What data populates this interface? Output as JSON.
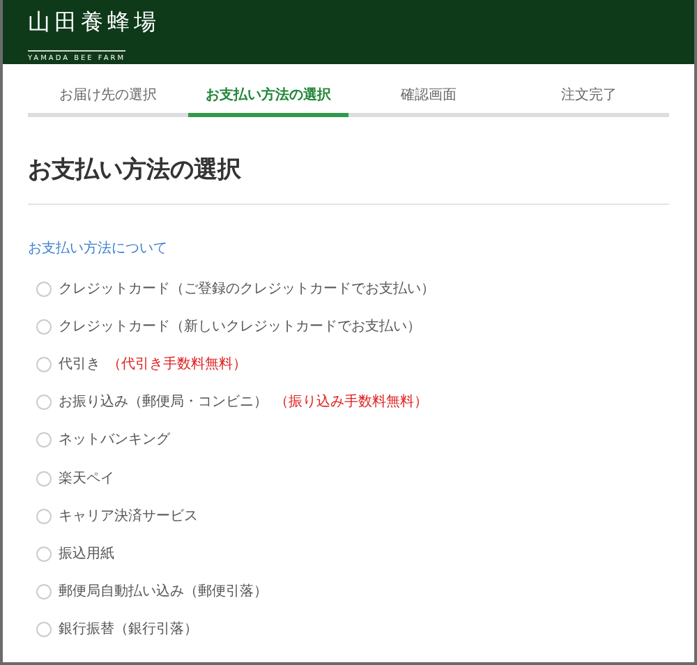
{
  "header": {
    "logo_title": "山田養蜂場",
    "logo_subtitle": "YAMADA BEE FARM"
  },
  "steps": [
    {
      "label": "お届け先の選択",
      "selected": false
    },
    {
      "label": "お支払い方法の選択",
      "selected": true
    },
    {
      "label": "確認画面",
      "selected": false
    },
    {
      "label": "注文完了",
      "selected": false
    }
  ],
  "page_title": "お支払い方法の選択",
  "help_link": "お支払い方法について",
  "payment_options": [
    {
      "label": "クレジットカード（ご登録のクレジットカードでお支払い）",
      "selected": false
    },
    {
      "label": "クレジットカード（新しいクレジットカードでお支払い）",
      "selected": false
    },
    {
      "label": "代引き",
      "note": "（代引き手数料無料）",
      "selected": false
    },
    {
      "label": "お振り込み（郵便局・コンビニ）",
      "note": "（振り込み手数料無料）",
      "selected": false
    },
    {
      "label": "ネットバンキング",
      "selected": false
    },
    {
      "label": "楽天ペイ",
      "selected": false
    },
    {
      "label": "キャリア決済サービス",
      "selected": false
    },
    {
      "label": "振込用紙",
      "selected": false
    },
    {
      "label": "郵便局自動払い込み（郵便引落）",
      "selected": false
    },
    {
      "label": "銀行振替（銀行引落）",
      "selected": false
    }
  ]
}
